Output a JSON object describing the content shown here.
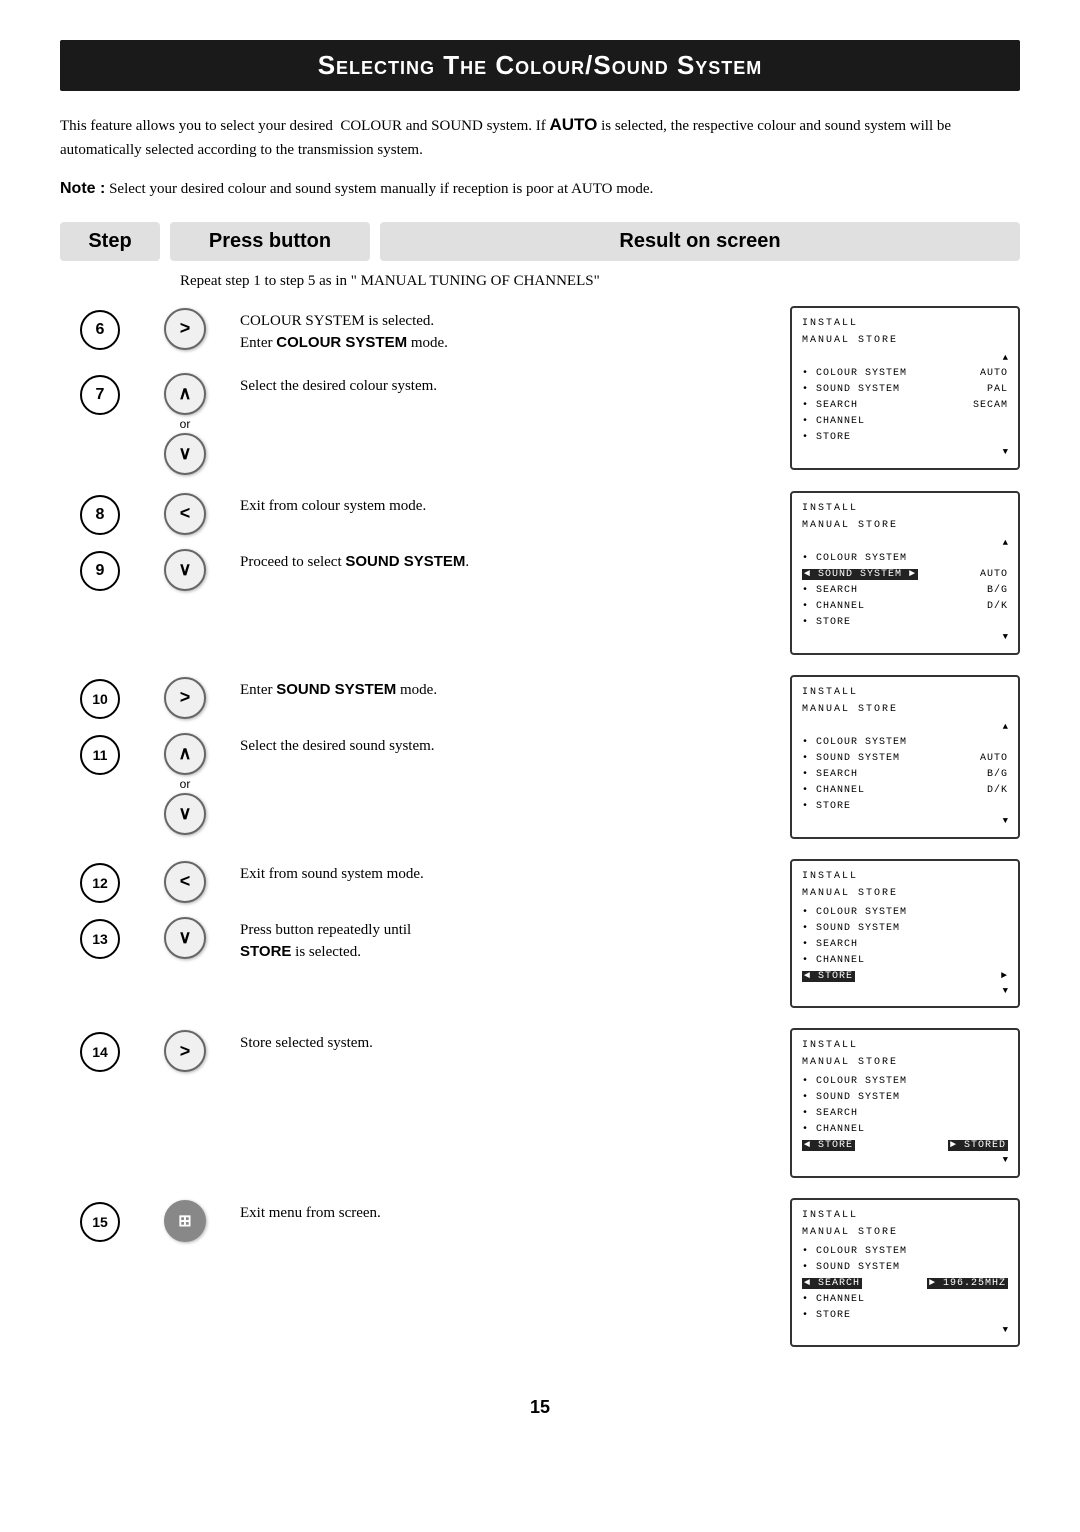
{
  "page": {
    "title": "Selecting The Colour/Sound System",
    "page_number": "15"
  },
  "intro": {
    "paragraph1": "This feature allows you to select your desired  COLOUR and SOUND system. If AUTO is selected, the respective colour and sound system will be automatically selected according to the transmission system.",
    "paragraph2": "Note : Select your desired colour and sound system manually if reception is poor at AUTO mode."
  },
  "headers": {
    "step": "Step",
    "press": "Press button",
    "result": "Result on screen"
  },
  "repeat_note": "Repeat step 1 to step 5 as in \" MANUAL TUNING OF CHANNELS\"",
  "steps": [
    {
      "num": "6",
      "btn": ">",
      "btn_style": "normal",
      "desc_line1": "COLOUR SYSTEM is selected.",
      "desc_line2": "Enter COLOUR SYSTEM mode.",
      "screen_index": 0
    },
    {
      "num": "7",
      "btn": "^",
      "btn_style": "normal",
      "btn2": "v",
      "has_or": true,
      "desc_line1": "Select the desired colour system.",
      "screen_index": null
    },
    {
      "num": "8",
      "btn": "<",
      "btn_style": "normal",
      "desc_line1": "Exit from colour system mode.",
      "screen_index": 1
    },
    {
      "num": "9",
      "btn": "v",
      "btn_style": "normal",
      "desc_line1": "Proceed to select SOUND SYSTEM.",
      "screen_index": null
    },
    {
      "num": "10",
      "btn": ">",
      "btn_style": "normal",
      "desc_line1": "Enter SOUND SYSTEM mode.",
      "screen_index": 2
    },
    {
      "num": "11",
      "btn": "^",
      "btn_style": "normal",
      "btn2": "v",
      "has_or": true,
      "desc_line1": "Select the desired sound system.",
      "screen_index": null
    },
    {
      "num": "12",
      "btn": "<",
      "btn_style": "normal",
      "desc_line1": "Exit from sound system mode.",
      "screen_index": 3
    },
    {
      "num": "13",
      "btn": "v",
      "btn_style": "normal",
      "desc_line1": "Press button repeatedly until",
      "desc_line2": "STORE is selected.",
      "screen_index": null
    },
    {
      "num": "14",
      "btn": ">",
      "btn_style": "normal",
      "desc_line1": "Store selected system.",
      "screen_index": 4
    },
    {
      "num": "15",
      "btn": "E",
      "btn_style": "icon",
      "desc_line1": "Exit menu from screen.",
      "screen_index": 5
    }
  ],
  "screens": [
    {
      "id": 0,
      "title": "INSTALL",
      "subtitle": "MANUAL STORE",
      "arrow_top": true,
      "rows": [
        {
          "label": "• COLOUR SYSTEM",
          "value": "AUTO",
          "highlight_label": false,
          "highlight_value": false
        },
        {
          "label": "• SOUND SYSTEM",
          "value": "PAL",
          "highlight_label": false,
          "highlight_value": false
        },
        {
          "label": "• SEARCH",
          "value": "SECAM",
          "highlight_label": false,
          "highlight_value": false
        },
        {
          "label": "• CHANNEL",
          "value": "",
          "highlight_label": false,
          "highlight_value": false
        },
        {
          "label": "• STORE",
          "value": "",
          "highlight_label": false,
          "highlight_value": false
        }
      ],
      "arrow_bottom": true
    },
    {
      "id": 1,
      "title": "INSTALL",
      "subtitle": "MANUAL STORE",
      "arrow_top": true,
      "rows": [
        {
          "label": "• COLOUR SYSTEM",
          "value": "",
          "highlight_label": false,
          "highlight_value": false
        },
        {
          "label": "◄ SOUND SYSTEM",
          "value": "AUTO",
          "highlight_label": true,
          "highlight_value": false,
          "label_prefix": "◄"
        },
        {
          "label": "• SEARCH",
          "value": "B/G",
          "highlight_label": false,
          "highlight_value": false
        },
        {
          "label": "• CHANNEL",
          "value": "D/K",
          "highlight_label": false,
          "highlight_value": false
        },
        {
          "label": "• STORE",
          "value": "",
          "highlight_label": false,
          "highlight_value": false
        }
      ],
      "arrow_bottom": true
    },
    {
      "id": 2,
      "title": "INSTALL",
      "subtitle": "MANUAL STORE",
      "arrow_top": true,
      "rows": [
        {
          "label": "• COLOUR SYSTEM",
          "value": "",
          "highlight_label": false,
          "highlight_value": false
        },
        {
          "label": "• SOUND SYSTEM",
          "value": "AUTO",
          "highlight_label": false,
          "highlight_value": false
        },
        {
          "label": "• SEARCH",
          "value": "B/G",
          "highlight_label": false,
          "highlight_value": false
        },
        {
          "label": "• CHANNEL",
          "value": "D/K",
          "highlight_label": false,
          "highlight_value": false
        },
        {
          "label": "• STORE",
          "value": "",
          "highlight_label": false,
          "highlight_value": false
        }
      ],
      "arrow_bottom": true
    },
    {
      "id": 3,
      "title": "INSTALL",
      "subtitle": "MANUAL STORE",
      "arrow_top": false,
      "rows": [
        {
          "label": "• COLOUR SYSTEM",
          "value": "",
          "highlight_label": false,
          "highlight_value": false
        },
        {
          "label": "• SOUND SYSTEM",
          "value": "",
          "highlight_label": false,
          "highlight_value": false
        },
        {
          "label": "• SEARCH",
          "value": "",
          "highlight_label": false,
          "highlight_value": false
        },
        {
          "label": "• CHANNEL",
          "value": "",
          "highlight_label": false,
          "highlight_value": false
        },
        {
          "label": "◄ STORE",
          "value": "►",
          "highlight_label": true,
          "highlight_value": false
        }
      ],
      "arrow_bottom": true
    },
    {
      "id": 4,
      "title": "INSTALL",
      "subtitle": "MANUAL STORE",
      "arrow_top": false,
      "rows": [
        {
          "label": "• COLOUR SYSTEM",
          "value": "",
          "highlight_label": false,
          "highlight_value": false
        },
        {
          "label": "• SOUND SYSTEM",
          "value": "",
          "highlight_label": false,
          "highlight_value": false
        },
        {
          "label": "• SEARCH",
          "value": "",
          "highlight_label": false,
          "highlight_value": false
        },
        {
          "label": "• CHANNEL",
          "value": "",
          "highlight_label": false,
          "highlight_value": false
        },
        {
          "label": "◄ STORE",
          "value": "► STORED",
          "highlight_label": true,
          "highlight_value": true
        }
      ],
      "arrow_bottom": true
    },
    {
      "id": 5,
      "title": "INSTALL",
      "subtitle": "MANUAL STORE",
      "arrow_top": false,
      "rows": [
        {
          "label": "• COLOUR SYSTEM",
          "value": "",
          "highlight_label": false,
          "highlight_value": false
        },
        {
          "label": "• SOUND SYSTEM",
          "value": "",
          "highlight_label": false,
          "highlight_value": false
        },
        {
          "label": "◄ SEARCH",
          "value": "► 196.25MHZ",
          "highlight_label": true,
          "highlight_value": true
        },
        {
          "label": "• CHANNEL",
          "value": "",
          "highlight_label": false,
          "highlight_value": false
        },
        {
          "label": "• STORE",
          "value": "",
          "highlight_label": false,
          "highlight_value": false
        }
      ],
      "arrow_bottom": true
    }
  ]
}
